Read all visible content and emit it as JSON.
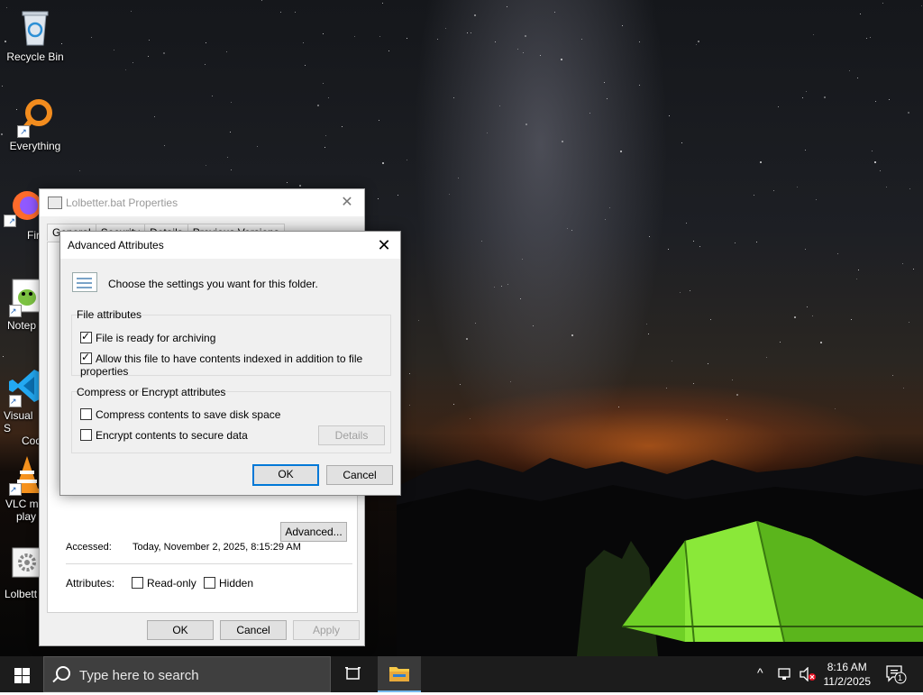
{
  "desktop": {
    "icons": [
      {
        "label": "Recycle Bin"
      },
      {
        "label": "Everything"
      },
      {
        "label": "Firef"
      },
      {
        "label": "Notep"
      },
      {
        "label": "Visual S",
        "label2": "Cod"
      },
      {
        "label": "VLC m",
        "label2": "play"
      },
      {
        "label": "Lolbett"
      }
    ]
  },
  "properties": {
    "title": "Lolbetter.bat Properties",
    "tabs": [
      "General",
      "Security",
      "Details",
      "Previous Versions"
    ],
    "accessed_label": "Accessed:",
    "accessed_value": "Today, November 2, 2025, 8:15:29 AM",
    "attributes_label": "Attributes:",
    "readonly_label": "Read-only",
    "readonly_checked": false,
    "hidden_label": "Hidden",
    "hidden_checked": false,
    "advanced_button": "Advanced...",
    "ok_button": "OK",
    "cancel_button": "Cancel",
    "apply_button": "Apply"
  },
  "advanced": {
    "title": "Advanced Attributes",
    "intro": "Choose the settings you want for this folder.",
    "file_attributes_label": "File attributes",
    "archive_label": "File is ready for archiving",
    "archive_checked": true,
    "index_label": "Allow this file to have contents indexed in addition to file properties",
    "index_checked": true,
    "compress_group_label": "Compress or Encrypt attributes",
    "compress_label": "Compress contents to save disk space",
    "compress_checked": false,
    "encrypt_label": "Encrypt contents to secure data",
    "encrypt_checked": false,
    "details_button": "Details",
    "ok_button": "OK",
    "cancel_button": "Cancel"
  },
  "taskbar": {
    "search_placeholder": "Type here to search",
    "time": "8:16 AM",
    "date": "11/2/2025",
    "notification_count": "1"
  },
  "colors": {
    "accent": "#0078d7",
    "taskbar": "#1c1c1c",
    "tent": "#7bdc2a",
    "sunset": "#ff7a1a"
  }
}
